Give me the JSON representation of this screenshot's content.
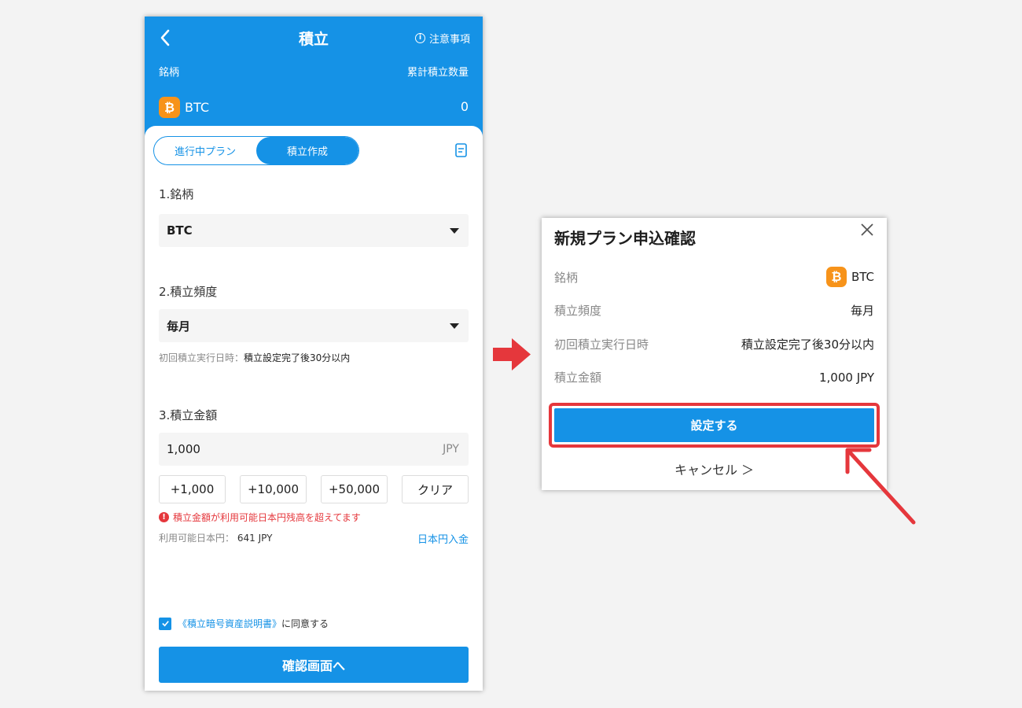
{
  "header": {
    "title": "積立",
    "notice": "注意事項",
    "coin_label": "銘柄",
    "qty_label": "累計積立数量",
    "coin_symbol": "BTC",
    "qty_value": "0",
    "coin_glyph": "₿"
  },
  "tabs": [
    {
      "label": "進行中プラン",
      "active": false
    },
    {
      "label": "積立作成",
      "active": true
    }
  ],
  "form": {
    "section1": "1.銘柄",
    "coin_value": "BTC",
    "section2": "2.積立頻度",
    "frequency_value": "毎月",
    "first_label": "初回積立実行日時：",
    "first_value": "積立設定完了後30分以内",
    "section3": "3.積立金額",
    "amount_value": "1,000",
    "amount_unit": "JPY",
    "quick": [
      "+1,000",
      "+10,000",
      "+50,000",
      "クリア"
    ],
    "error": "積立金額が利用可能日本円残高を超えてます",
    "avail_label": "利用可能日本円：",
    "avail_value": "641 JPY",
    "deposit": "日本円入金",
    "agree_link": "《積立暗号資産説明書》",
    "agree_text": "に同意する",
    "agree_checked": true,
    "confirm": "確認画面へ"
  },
  "modal": {
    "title": "新規プラン申込確認",
    "rows": [
      {
        "k": "銘柄",
        "v": "BTC"
      },
      {
        "k": "積立頻度",
        "v": "毎月"
      },
      {
        "k": "初回積立実行日時",
        "v": "積立設定完了後30分以内"
      },
      {
        "k": "積立金額",
        "v": "1,000 JPY"
      }
    ],
    "set": "設定する",
    "cancel": "キャンセル ＞"
  },
  "colors": {
    "accent": "#1592e6",
    "error": "#e5373c",
    "btc": "#f7931a"
  }
}
